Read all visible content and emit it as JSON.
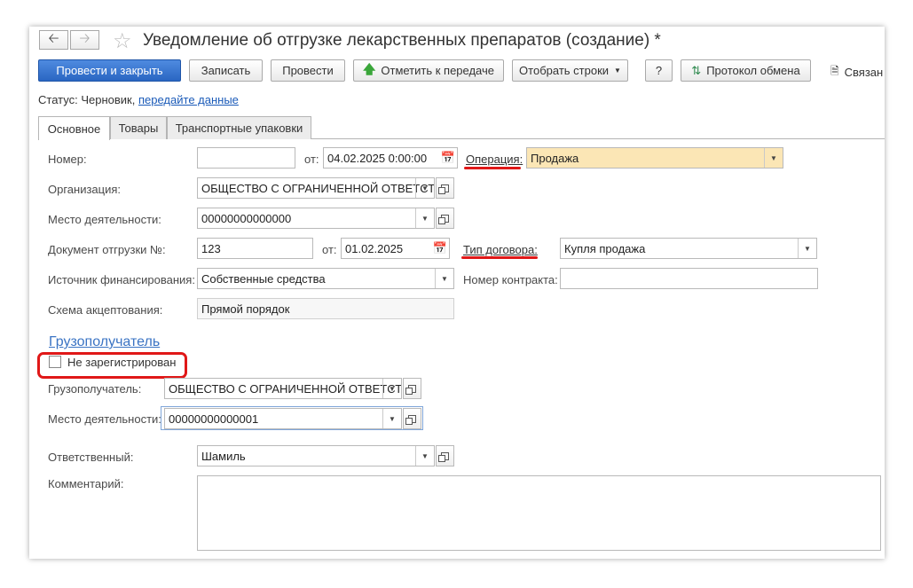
{
  "window": {
    "title": "Уведомление об отгрузке лекарственных препаратов (создание) *"
  },
  "nav": {
    "back_icon": "arrow-left-icon",
    "forward_icon": "arrow-right-icon",
    "favorite_icon": "star-icon"
  },
  "toolbar": {
    "post_close": "Провести и закрыть",
    "save": "Записать",
    "post": "Провести",
    "mark_transfer": "Отметить к передаче",
    "select_rows": "Отобрать строки",
    "help": "?",
    "exchange_log": "Протокол обмена",
    "linked": "Связан"
  },
  "status": {
    "label": "Статус:",
    "value": "Черновик,",
    "link": "передайте данные"
  },
  "tabs": [
    {
      "label": "Основное"
    },
    {
      "label": "Товары"
    },
    {
      "label": "Транспортные упаковки"
    }
  ],
  "form": {
    "number_label": "Номер:",
    "number_value": "",
    "from_label": "от:",
    "date_value": "04.02.2025  0:00:00",
    "operation_label": "Операция:",
    "operation_value": "Продажа",
    "org_label": "Организация:",
    "org_value": "ОБЩЕСТВО С ОГРАНИЧЕННОЙ ОТВЕТСТВЕННОСТЬЮ",
    "place_label": "Место деятельности:",
    "place_value": "00000000000000",
    "ship_doc_label": "Документ отгрузки №:",
    "ship_doc_value": "123",
    "ship_from_label": "от:",
    "ship_date_value": "01.02.2025",
    "contract_type_label": "Тип договора:",
    "contract_type_value": "Купля продажа",
    "finance_label": "Источник финансирования:",
    "finance_value": "Собственные средства",
    "contract_no_label": "Номер контракта:",
    "contract_no_value": "",
    "scheme_label": "Схема акцептования:",
    "scheme_value": "Прямой порядок"
  },
  "consignee": {
    "section_title": "Грузополучатель",
    "not_registered_label": "Не зарегистрирован",
    "consignee_label": "Грузополучатель:",
    "consignee_value": "ОБЩЕСТВО С ОГРАНИЧЕННОЙ ОТВЕТСТВЕННОСТЬЮ",
    "place_label": "Место деятельности:",
    "place_value": "00000000000001"
  },
  "footer": {
    "responsible_label": "Ответственный:",
    "responsible_value": "Шамиль",
    "comment_label": "Комментарий:",
    "comment_value": ""
  },
  "colors": {
    "primary_button": "#2a66c2",
    "highlight_field": "#fbe6b5",
    "annotation_red": "#e01818",
    "link": "#1a5ab8"
  }
}
